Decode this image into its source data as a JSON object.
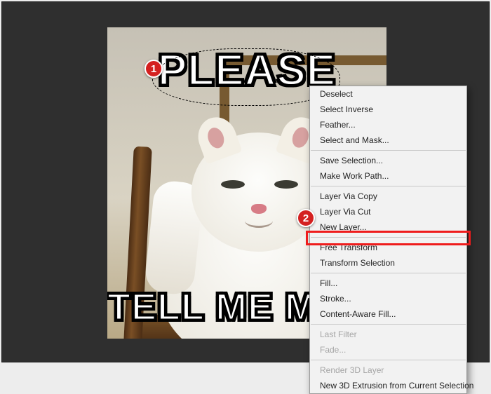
{
  "meme": {
    "top_text": "PLEASE",
    "bottom_text": "TELL ME MORE"
  },
  "callouts": {
    "step1": "1",
    "step2": "2"
  },
  "context_menu": {
    "group1": [
      {
        "label": "Deselect",
        "enabled": true
      },
      {
        "label": "Select Inverse",
        "enabled": true
      },
      {
        "label": "Feather...",
        "enabled": true
      },
      {
        "label": "Select and Mask...",
        "enabled": true
      }
    ],
    "group2": [
      {
        "label": "Save Selection...",
        "enabled": true
      },
      {
        "label": "Make Work Path...",
        "enabled": true
      }
    ],
    "group3": [
      {
        "label": "Layer Via Copy",
        "enabled": true
      },
      {
        "label": "Layer Via Cut",
        "enabled": true
      },
      {
        "label": "New Layer...",
        "enabled": true
      }
    ],
    "group4": [
      {
        "label": "Free Transform",
        "enabled": true
      },
      {
        "label": "Transform Selection",
        "enabled": true
      }
    ],
    "group5": [
      {
        "label": "Fill...",
        "enabled": true
      },
      {
        "label": "Stroke...",
        "enabled": true
      },
      {
        "label": "Content-Aware Fill...",
        "enabled": true
      }
    ],
    "group6": [
      {
        "label": "Last Filter",
        "enabled": false
      },
      {
        "label": "Fade...",
        "enabled": false
      }
    ],
    "group7": [
      {
        "label": "Render 3D Layer",
        "enabled": false
      },
      {
        "label": "New 3D Extrusion from Current Selection",
        "enabled": true
      }
    ]
  }
}
